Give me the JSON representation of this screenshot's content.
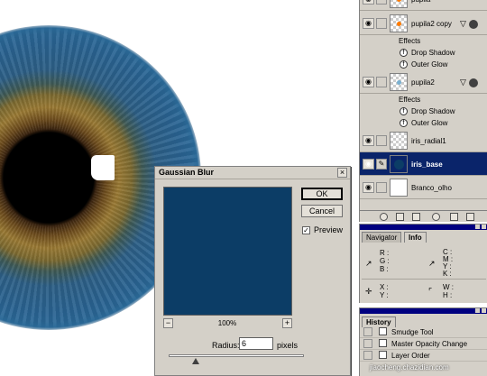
{
  "gaussian_blur": {
    "title": "Gaussian Blur",
    "close_glyph": "×",
    "ok_label": "OK",
    "cancel_label": "Cancel",
    "preview_label": "Preview",
    "preview_checked": true,
    "preview_check_glyph": "✓",
    "zoom_level": "100%",
    "zoom_out_glyph": "−",
    "zoom_in_glyph": "+",
    "radius_label": "Radius:",
    "radius_value": "6",
    "radius_unit": "pixels",
    "radius_slider_fraction": 0.2,
    "preview_color": "#0c3d66"
  },
  "layers": {
    "rows": [
      {
        "name": "pupila",
        "thumb_dot": "#ff7a00"
      },
      {
        "name": "pupila2 copy",
        "fx_badge": "▽",
        "thumb_dot": "#ff7a00"
      },
      {
        "name": "pupila2",
        "fx_badge": "▽",
        "thumb_dot": "#7ab0d0"
      },
      {
        "name": "iris_radial1"
      },
      {
        "name": "iris_base",
        "selected": true,
        "thumb_dot": "#0c3d66"
      },
      {
        "name": "Branco_olho"
      }
    ],
    "effects_label": "Effects",
    "effects": [
      "Drop Shadow",
      "Outer Glow"
    ],
    "effect_glyph": "f",
    "eye_glyph": "◉",
    "brush_glyph": "✎",
    "toolbar_icons": [
      "layer-style-icon",
      "layer-mask-icon",
      "new-set-icon",
      "adjustment-layer-icon",
      "new-layer-icon",
      "trash-icon"
    ],
    "selection_color": "#0a246a"
  },
  "navinfo": {
    "tabs": [
      "Navigator",
      "Info"
    ],
    "active_tab": "Info",
    "rgb_labels": [
      "R :",
      "G :",
      "B :"
    ],
    "cmyk_labels": [
      "C :",
      "M :",
      "Y :",
      "K :"
    ],
    "xy_labels": [
      "X :",
      "Y :"
    ],
    "wh_labels": [
      "W :",
      "H :"
    ],
    "eyedropper_glyph": "↗",
    "crosshair_glyph": "✛",
    "corner_glyph": "⌜"
  },
  "history": {
    "tab": "History",
    "items": [
      "Smudge Tool",
      "Master Opacity Change",
      "Layer Order"
    ]
  },
  "watermark": "jiaocheng.chazidian.com"
}
